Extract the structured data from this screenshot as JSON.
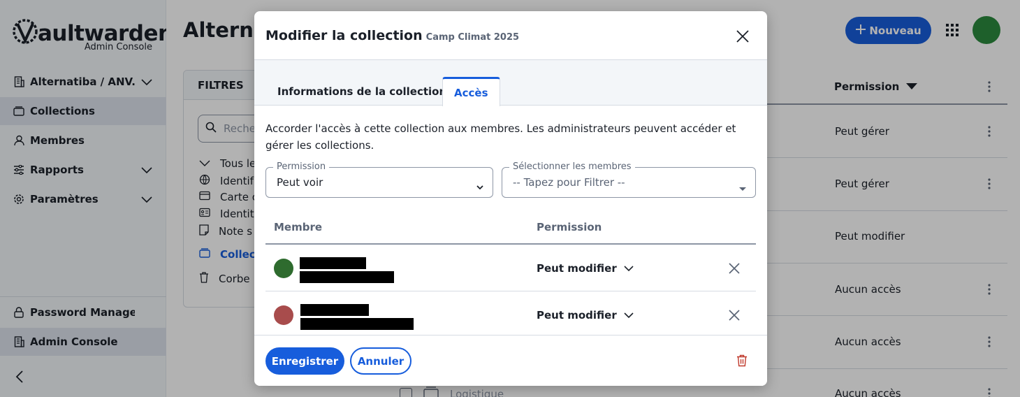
{
  "brand": {
    "logo_text": "aultwarden",
    "logo_sub": "Admin Console"
  },
  "sidebar": {
    "items": [
      {
        "label": "Alternatiba / ANV..."
      },
      {
        "label": "Collections"
      },
      {
        "label": "Membres"
      },
      {
        "label": "Rapports"
      },
      {
        "label": "Paramètres"
      }
    ],
    "footer": [
      {
        "label": "Password Manager"
      },
      {
        "label": "Admin Console"
      }
    ]
  },
  "main": {
    "title": "Alterna",
    "new_button": "Nouveau",
    "filters": {
      "header": "FILTRES",
      "search_placeholder": "Reche",
      "items": [
        "Tous le",
        "Identif",
        "Carte c",
        "Identit",
        "Note s",
        "Collec",
        "Corbe"
      ]
    },
    "table": {
      "permission_header": "Permission",
      "rows": [
        "Peut gérer",
        "Peut gérer",
        "Peut modifier",
        "Aucun accès",
        "Aucun accès",
        "Aucun accès"
      ],
      "partial_row_name": "Logistique"
    }
  },
  "modal": {
    "title": "Modifier la collection",
    "subtitle": "Camp Climat 2025",
    "tabs": [
      {
        "label": "Informations de la collection"
      },
      {
        "label": "Accès"
      }
    ],
    "description": "Accorder l'accès à cette collection aux membres. Les administrateurs peuvent accéder et gérer les collections.",
    "permission_field": {
      "label": "Permission",
      "value": "Peut voir"
    },
    "members_field": {
      "label": "Sélectionner les membres",
      "placeholder": "-- Tapez pour Filtrer --"
    },
    "table": {
      "headers": {
        "member": "Membre",
        "permission": "Permission"
      },
      "rows": [
        {
          "permission": "Peut modifier",
          "avatar_color": "#2e6b2e"
        },
        {
          "permission": "Peut modifier",
          "avatar_color": "#a84c4c"
        }
      ]
    },
    "footer": {
      "save": "Enregistrer",
      "cancel": "Annuler"
    }
  },
  "colors": {
    "primary": "#175ddc",
    "danger": "#c0392b",
    "sidebar_bg": "#f3f6f9"
  }
}
